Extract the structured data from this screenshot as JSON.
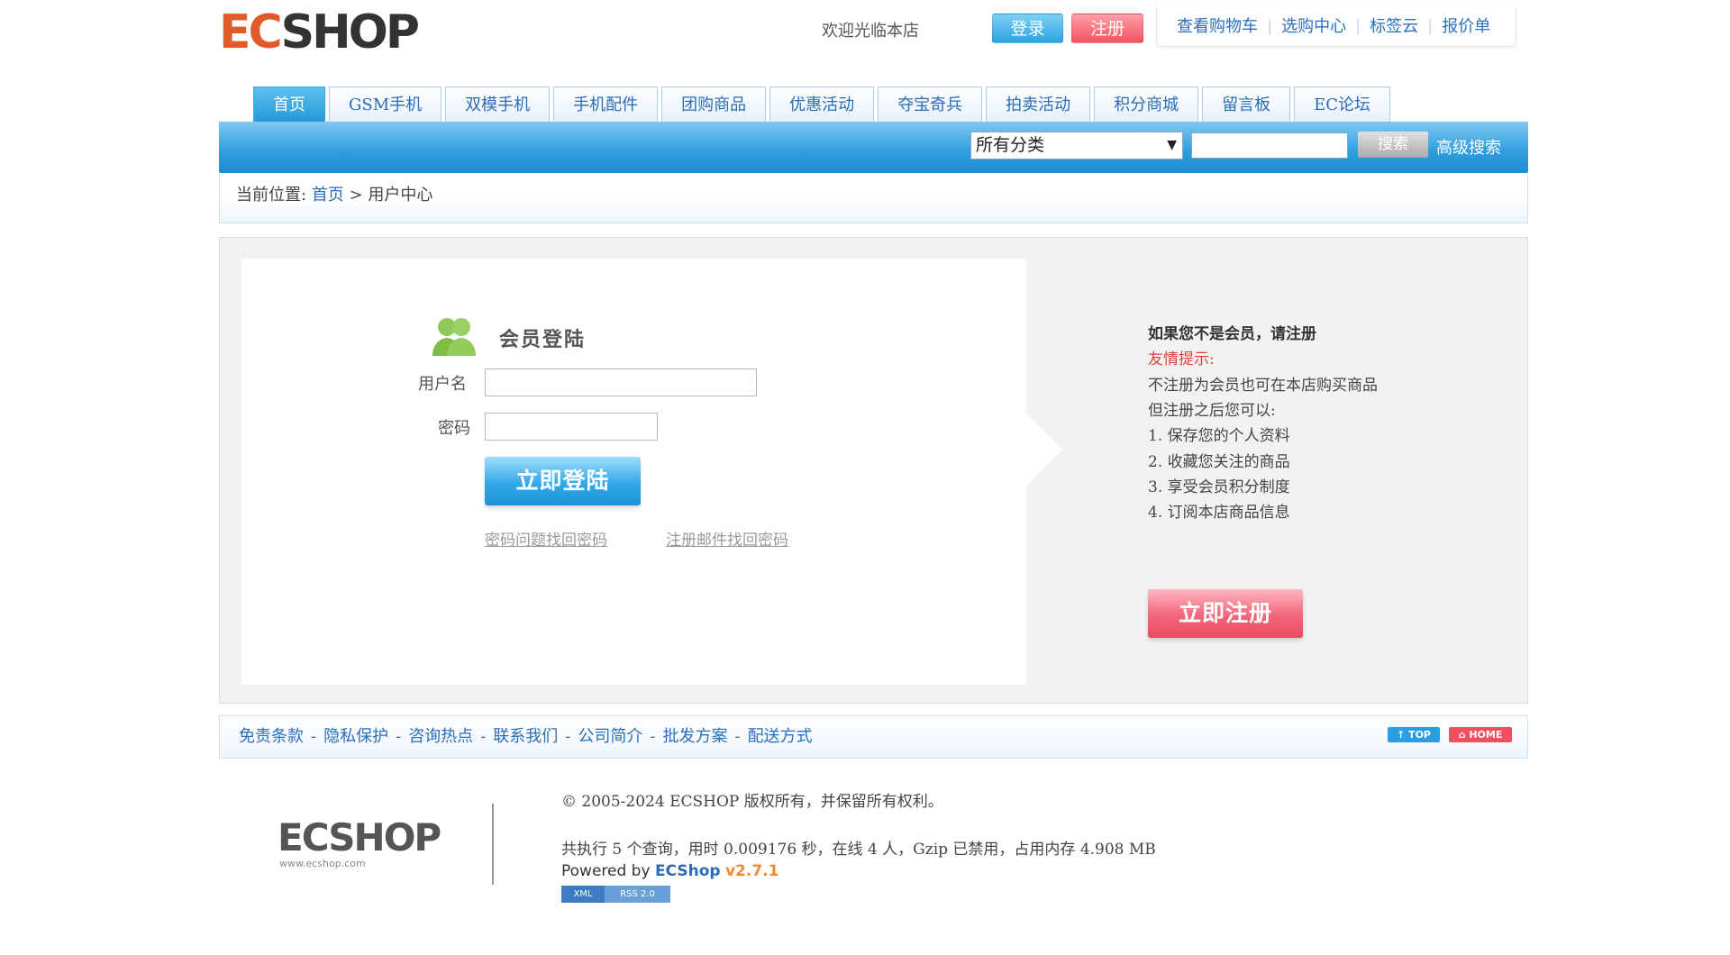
{
  "header": {
    "logo": "ECSHOP",
    "welcome": "欢迎光临本店",
    "login_label": "登录",
    "register_label": "注册",
    "top_links": [
      "查看购物车",
      "选购中心",
      "标签云",
      "报价单"
    ]
  },
  "nav": {
    "tabs": [
      "首页",
      "GSM手机",
      "双模手机",
      "手机配件",
      "团购商品",
      "优惠活动",
      "夺宝奇兵",
      "拍卖活动",
      "积分商城",
      "留言板",
      "EC论坛"
    ],
    "active_index": 0
  },
  "search": {
    "category_selected": "所有分类",
    "keyword_value": "",
    "button_label": "搜索",
    "advanced_label": "高级搜索"
  },
  "breadcrumb": {
    "prefix": "当前位置:",
    "home": "首页",
    "separator": ">",
    "current": "用户中心"
  },
  "login": {
    "title": "会员登陆",
    "username_label": "用户名",
    "password_label": "密码",
    "username_value": "",
    "password_value": "",
    "submit_label": "立即登陆",
    "recover_question": "密码问题找回密码",
    "recover_email": "注册邮件找回密码"
  },
  "register_side": {
    "heading": "如果您不是会员，请注册",
    "tip_label": "友情提示:",
    "line1": "不注册为会员也可在本店购买商品",
    "line2": "但注册之后您可以:",
    "benefits": [
      "1. 保存您的个人资料",
      "2. 收藏您关注的商品",
      "3. 享受会员积分制度",
      "4. 订阅本店商品信息"
    ],
    "submit_label": "立即注册"
  },
  "footer": {
    "links": [
      "免责条款",
      "隐私保护",
      "咨询热点",
      "联系我们",
      "公司简介",
      "批发方案",
      "配送方式"
    ],
    "top_label": "↑ TOP",
    "home_label": "⌂ HOME",
    "logo": "ECSHOP",
    "logo_url": "www.ecshop.com",
    "copyright": "© 2005-2024 ECSHOP 版权所有，并保留所有权利。",
    "stats": "共执行 5 个查询，用时 0.009176 秒，在线 4 人，Gzip 已禁用，占用内存 4.908 MB",
    "powered_prefix": "Powered by",
    "powered_brand": "ECShop",
    "powered_version": "v2.7.1",
    "rss_xml": "XML",
    "rss_label": "RSS 2.0"
  },
  "colors": {
    "brand_blue": "#2a9ee2",
    "brand_red": "#ef4f5f",
    "link": "#2a6fc0"
  }
}
